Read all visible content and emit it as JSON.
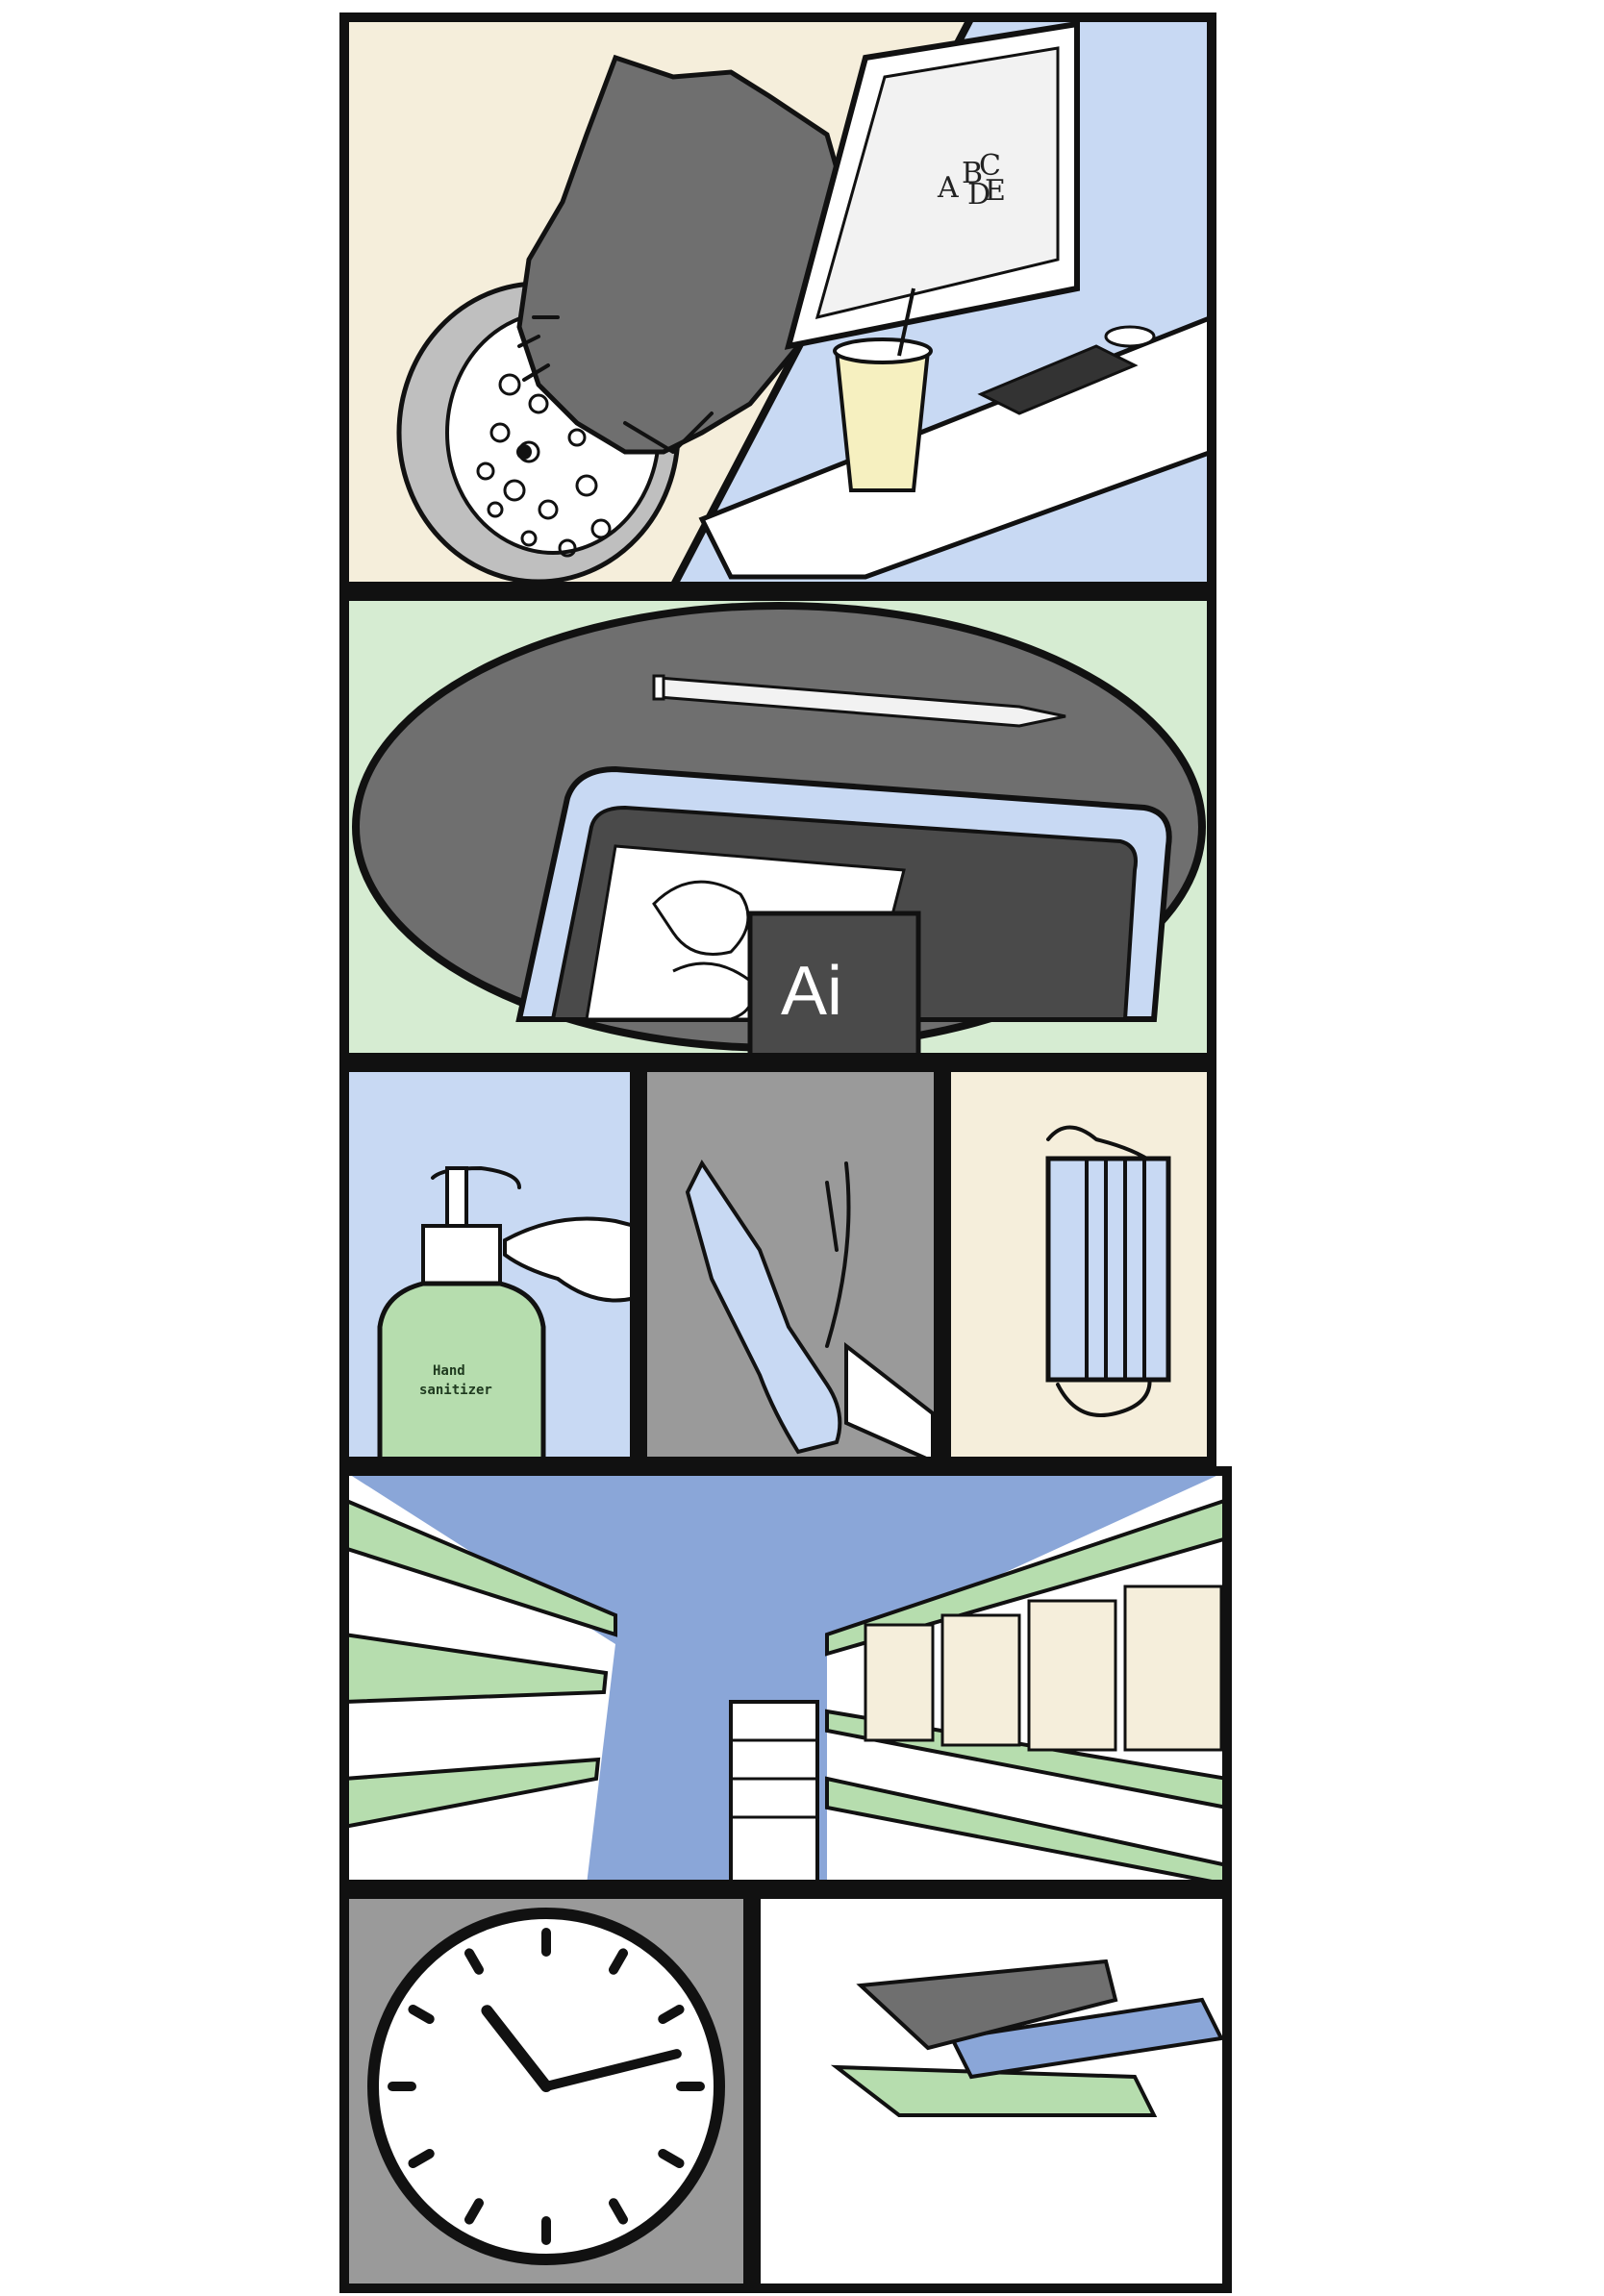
{
  "colors": {
    "cream": "#f5eedb",
    "light_blue": "#c8d9f3",
    "mid_blue": "#8aa6d8",
    "green": "#b6ddae",
    "light_green": "#d6ecd2",
    "gray": "#9a9a9a",
    "dark_gray": "#6f6f6f",
    "ink": "#111111"
  },
  "screen_letters": {
    "a": "A",
    "b": "B",
    "c": "C",
    "d": "D",
    "e": "E"
  },
  "app_badge": "Ai",
  "bottle_label": {
    "line1": "Hand",
    "line2": "sanitizer"
  },
  "clock": {
    "hour_hand_deg": -38,
    "minute_hand_deg": 76
  }
}
